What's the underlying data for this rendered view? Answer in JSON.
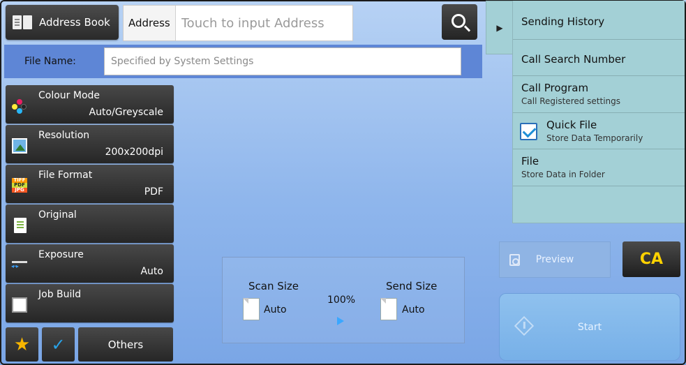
{
  "topbar": {
    "address_book_label": "Address Book",
    "address_label": "Address",
    "address_placeholder": "Touch to input Address"
  },
  "filename": {
    "label": "File Name:",
    "placeholder": "Specified by System Settings"
  },
  "functions": [
    {
      "title": "Colour Mode",
      "value": "Auto/Greyscale",
      "icon": "colour-mode-icon"
    },
    {
      "title": "Resolution",
      "value": "200x200dpi",
      "icon": "resolution-icon"
    },
    {
      "title": "File Format",
      "value": "PDF",
      "icon": "file-format-icon"
    },
    {
      "title": "Original",
      "value": "",
      "icon": "original-icon"
    },
    {
      "title": "Exposure",
      "value": "Auto",
      "icon": "exposure-icon"
    },
    {
      "title": "Job Build",
      "value": "",
      "icon": "job-build-icon"
    }
  ],
  "bottom": {
    "others_label": "Others"
  },
  "scan_info": {
    "scan_size_label": "Scan Size",
    "scan_size_value": "Auto",
    "ratio": "100%",
    "send_size_label": "Send Size",
    "send_size_value": "Auto"
  },
  "side_panel": {
    "items": [
      {
        "main": "Sending History",
        "sub": ""
      },
      {
        "main": "Call Search Number",
        "sub": ""
      },
      {
        "main": "Call Program",
        "sub": "Call Registered settings"
      },
      {
        "main": "Quick File",
        "sub": "Store Data Temporarily",
        "checked": true
      },
      {
        "main": "File",
        "sub": "Store Data in Folder"
      }
    ]
  },
  "actions": {
    "preview_label": "Preview",
    "ca_label": "CA",
    "start_label": "Start"
  },
  "colors": {
    "accent_blue": "#5e86d6",
    "panel_teal": "#a3d0d6",
    "ca_yellow": "#ffd200",
    "star_yellow": "#f7b500",
    "check_blue": "#1f8fd6"
  }
}
